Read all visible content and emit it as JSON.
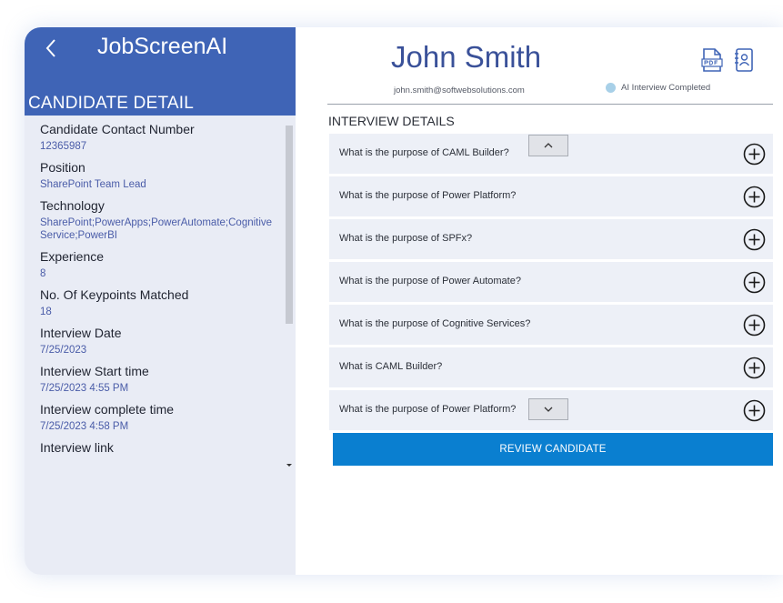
{
  "app": {
    "title": "JobScreenAI"
  },
  "sidebar": {
    "section_title": "CANDIDATE DETAIL",
    "details": [
      {
        "label": "Candidate Contact Number",
        "value": "12365987"
      },
      {
        "label": "Position",
        "value": "SharePoint Team Lead"
      },
      {
        "label": "Technology",
        "value": "SharePoint;PowerApps;PowerAutomate;Cognitive Service;PowerBI"
      },
      {
        "label": "Experience",
        "value": "8"
      },
      {
        "label": "No. Of Keypoints Matched",
        "value": "18"
      },
      {
        "label": "Interview Date",
        "value": "7/25/2023"
      },
      {
        "label": "Interview Start time",
        "value": "7/25/2023 4:55 PM"
      },
      {
        "label": "Interview complete time",
        "value": "7/25/2023 4:58 PM"
      },
      {
        "label": "Interview link",
        "value": ""
      }
    ]
  },
  "candidate": {
    "name": "John Smith",
    "email": "john.smith@softwebsolutions.com",
    "status": "AI Interview Completed"
  },
  "icons": {
    "back": "chevron-left-icon",
    "pdf": "pdf-file-icon",
    "profile": "contact-book-icon",
    "expand": "plus-circle-icon"
  },
  "interview": {
    "title": "INTERVIEW DETAILS",
    "questions": [
      "What is the purpose of CAML Builder?",
      "What is the purpose of Power Platform?",
      "What is the purpose of SPFx?",
      "What is the purpose of Power Automate?",
      "What is the purpose of Cognitive Services?",
      "What is CAML Builder?",
      "What is the purpose of Power Platform?"
    ]
  },
  "actions": {
    "review_label": "REVIEW CANDIDATE"
  },
  "colors": {
    "header_blue": "#3f64b6",
    "name_blue": "#3a5199",
    "review_button": "#0a7fd0",
    "status_dot": "#a8d0e8"
  }
}
